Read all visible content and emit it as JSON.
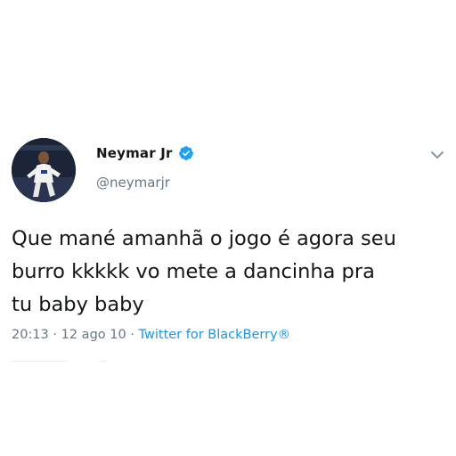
{
  "tweet": {
    "author": {
      "display_name": "Neymar Jr",
      "handle": "@neymarjr",
      "verified_icon": "verified-badge-icon",
      "avatar_icon": "avatar-photo"
    },
    "text": "Que mané amanhã o jogo é agora seu\nburro kkkkk vo mete a dancinha pra\ntu baby baby",
    "time": "20:13",
    "separator": " · ",
    "date": "12 ago 10",
    "source": "Twitter for BlackBerry®",
    "menu_icon": "chevron-down-icon"
  },
  "colors": {
    "text": "#14171a",
    "secondary": "#657786",
    "link": "#1b95e0",
    "verified": "#1da1f2"
  }
}
